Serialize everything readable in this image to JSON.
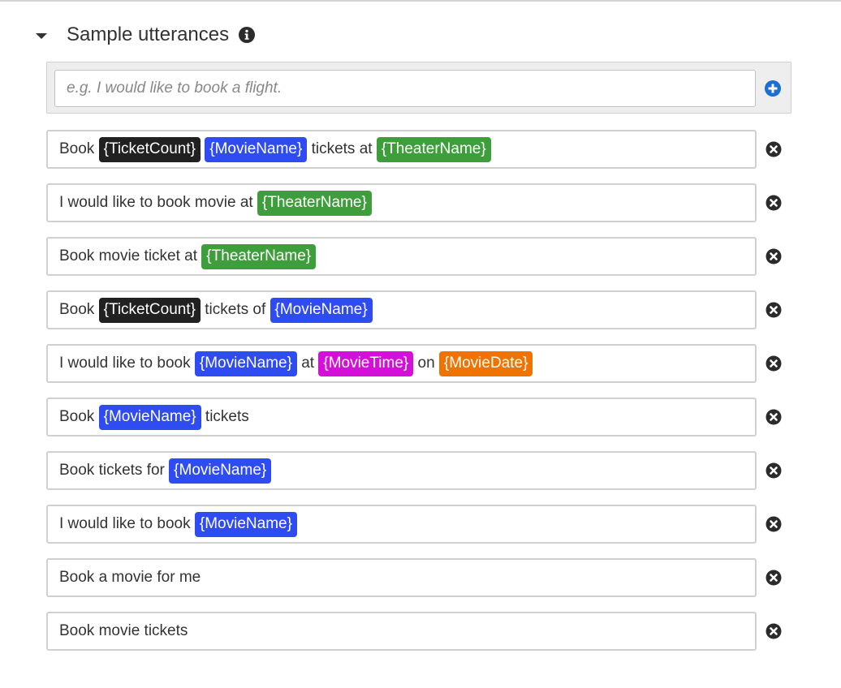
{
  "section": {
    "title": "Sample utterances",
    "expand_icon": "caret-down-icon",
    "info_icon": "info-icon"
  },
  "add_utterance": {
    "placeholder": "e.g. I would like to book a flight.",
    "value": "",
    "add_icon": "plus-circle-icon"
  },
  "slot_colors": {
    "TicketCount": "#212121",
    "MovieName": "#2f4cf2",
    "TheaterName": "#3f9e3c",
    "MovieTime": "#d410d8",
    "MovieDate": "#ef7300"
  },
  "utterances": [
    {
      "parts": [
        {
          "t": "Book "
        },
        {
          "slot": "{TicketCount}",
          "type": "TicketCount"
        },
        {
          "t": " "
        },
        {
          "slot": "{MovieName}",
          "type": "MovieName"
        },
        {
          "t": " tickets at "
        },
        {
          "slot": "{TheaterName}",
          "type": "TheaterName"
        }
      ]
    },
    {
      "parts": [
        {
          "t": "I would like to book movie at "
        },
        {
          "slot": "{TheaterName}",
          "type": "TheaterName"
        }
      ]
    },
    {
      "parts": [
        {
          "t": "Book movie ticket at "
        },
        {
          "slot": "{TheaterName}",
          "type": "TheaterName"
        }
      ]
    },
    {
      "parts": [
        {
          "t": "Book "
        },
        {
          "slot": "{TicketCount}",
          "type": "TicketCount"
        },
        {
          "t": " tickets of "
        },
        {
          "slot": "{MovieName}",
          "type": "MovieName"
        }
      ]
    },
    {
      "parts": [
        {
          "t": "I would like to book "
        },
        {
          "slot": "{MovieName}",
          "type": "MovieName"
        },
        {
          "t": " at "
        },
        {
          "slot": "{MovieTime}",
          "type": "MovieTime"
        },
        {
          "t": " on "
        },
        {
          "slot": "{MovieDate}",
          "type": "MovieDate"
        }
      ]
    },
    {
      "parts": [
        {
          "t": "Book "
        },
        {
          "slot": "{MovieName}",
          "type": "MovieName"
        },
        {
          "t": " tickets"
        }
      ]
    },
    {
      "parts": [
        {
          "t": "Book tickets for "
        },
        {
          "slot": "{MovieName}",
          "type": "MovieName"
        }
      ]
    },
    {
      "parts": [
        {
          "t": "I would like to book "
        },
        {
          "slot": "{MovieName}",
          "type": "MovieName"
        }
      ]
    },
    {
      "parts": [
        {
          "t": "Book a movie for me"
        }
      ]
    },
    {
      "parts": [
        {
          "t": "Book movie tickets"
        }
      ]
    }
  ],
  "remove_icon": "close-circle-icon"
}
